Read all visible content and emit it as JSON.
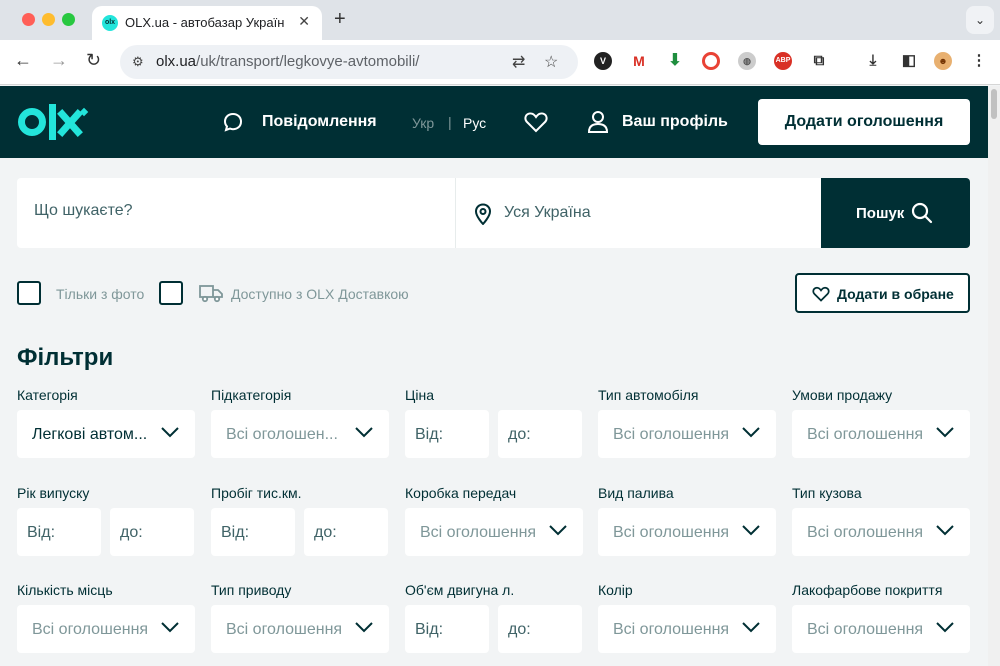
{
  "browser": {
    "tab_title": "OLX.ua - автобазар України",
    "favicon_text": "olx",
    "url_host": "olx.ua",
    "url_path": "/uk/transport/legkovye-avtomobili/"
  },
  "header": {
    "messages_label": "Повідомлення",
    "lang_ukr": "Укр",
    "lang_separator": "|",
    "lang_rus": "Рус",
    "profile_label": "Ваш профіль",
    "add_ad_label": "Додати оголошення"
  },
  "search": {
    "placeholder": "Що шукаєте?",
    "location": "Уся Україна",
    "button_label": "Пошук"
  },
  "options": {
    "photo_only": "Тільки з фото",
    "olx_delivery": "Доступно з OLX Доставкою",
    "add_favorite": "Додати в обране"
  },
  "filters": {
    "title": "Фільтри",
    "category": {
      "label": "Категорія",
      "value": "Легкові автом..."
    },
    "subcategory": {
      "label": "Підкатегорія",
      "value": "Всі оголошен..."
    },
    "price": {
      "label": "Ціна",
      "from": "Від:",
      "to": "до:"
    },
    "car_type": {
      "label": "Тип автомобіля",
      "value": "Всі оголошення"
    },
    "sale_terms": {
      "label": "Умови продажу",
      "value": "Всі оголошення"
    },
    "year": {
      "label": "Рік випуску",
      "from": "Від:",
      "to": "до:"
    },
    "mileage": {
      "label": "Пробіг тис.км.",
      "from": "Від:",
      "to": "до:"
    },
    "gearbox": {
      "label": "Коробка передач",
      "value": "Всі оголошення"
    },
    "fuel": {
      "label": "Вид палива",
      "value": "Всі оголошення"
    },
    "body": {
      "label": "Тип кузова",
      "value": "Всі оголошення"
    },
    "seats": {
      "label": "Кількість місць",
      "value": "Всі оголошення"
    },
    "drive": {
      "label": "Тип приводу",
      "value": "Всі оголошення"
    },
    "engine": {
      "label": "Об'єм двигуна л.",
      "from": "Від:",
      "to": "до:"
    },
    "color": {
      "label": "Колір",
      "value": "Всі оголошення"
    },
    "paint": {
      "label": "Лакофарбове покриття",
      "value": "Всі оголошення"
    }
  },
  "colors": {
    "brand_dark": "#002f34",
    "brand_teal": "#23e5db"
  }
}
